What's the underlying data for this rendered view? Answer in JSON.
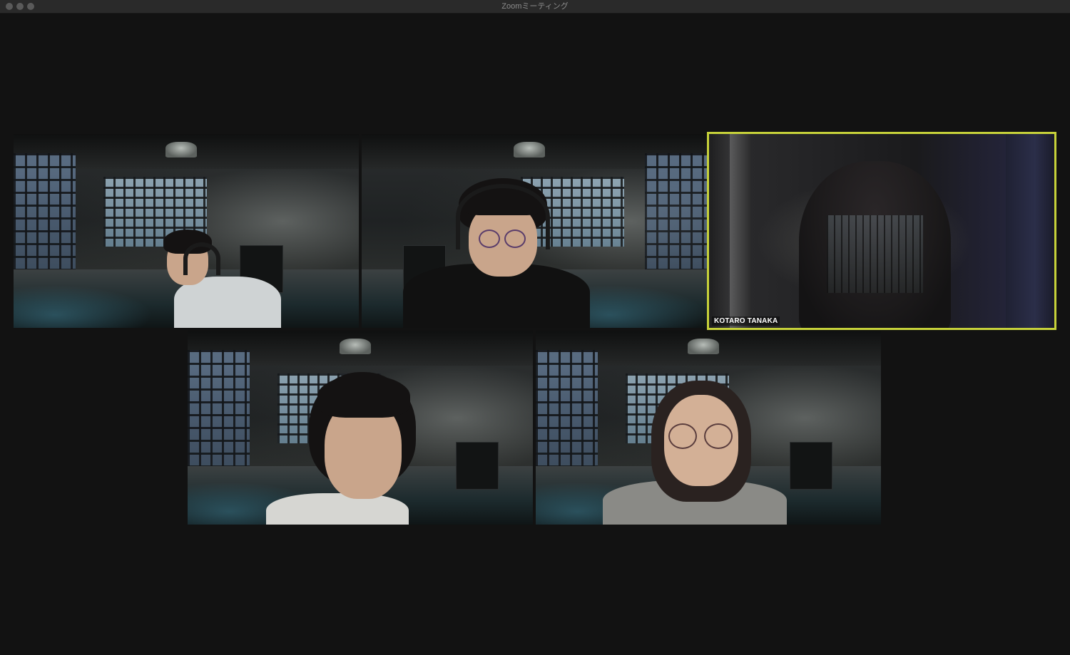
{
  "window": {
    "title": "Zoomミーティング"
  },
  "participants": [
    {
      "id": "p1",
      "name": "",
      "speaking": false
    },
    {
      "id": "p2",
      "name": "",
      "speaking": false
    },
    {
      "id": "p3",
      "name": "KOTARO TANAKA",
      "speaking": true
    },
    {
      "id": "p4",
      "name": "",
      "speaking": false
    },
    {
      "id": "p5",
      "name": "",
      "speaking": false
    }
  ],
  "colors": {
    "window_bg": "#121212",
    "titlebar_bg": "#2a2a2a",
    "active_speaker_border": "#c6d13a",
    "name_text": "#ffffff"
  },
  "icons": {
    "close": "traffic-light-close-icon",
    "minimize": "traffic-light-minimize-icon",
    "maximize": "traffic-light-maximize-icon"
  }
}
